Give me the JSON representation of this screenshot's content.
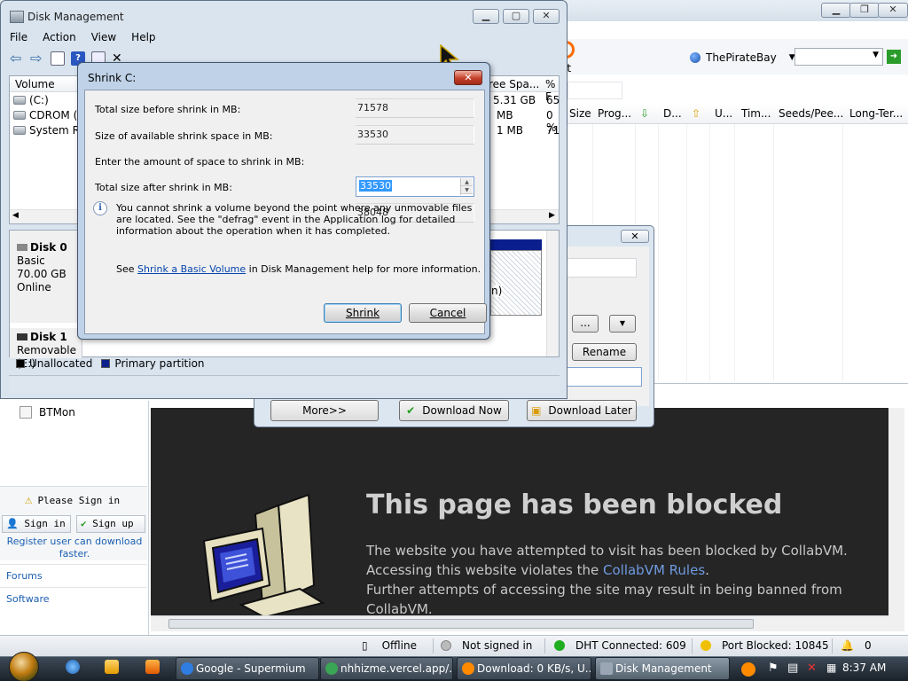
{
  "browser": {
    "search_engine": "ThePirateBay",
    "toolbar_partial_label": "it",
    "columns": [
      "Size",
      "Prog...",
      "D...",
      "U...",
      "Tim...",
      "Seeds/Pee...",
      "Long-Ter..."
    ],
    "left_nav": {
      "btmon": "BTMon",
      "please_sign_in": "Please Sign in",
      "sign_in": "Sign in",
      "sign_up": "Sign up",
      "register": "Register user can download faster.",
      "forums": "Forums",
      "software": "Software"
    },
    "blocked": {
      "title": "This page has been blocked",
      "line1": "The website you have attempted to visit has been blocked by CollabVM.",
      "line2_pre": "Accessing this website violates the ",
      "line2_link": "CollabVM Rules",
      "line2_post": ".",
      "line3": "Further attempts of accessing the site may result in being banned from CollabVM."
    },
    "status": {
      "offline": "Offline",
      "not_signed_in": "Not signed in",
      "dht": "DHT Connected: 609",
      "port": "Port Blocked: 10845",
      "count": "0"
    }
  },
  "download_dialog": {
    "browse": "...",
    "rename": "Rename",
    "more": "More>>",
    "download_now": "Download Now",
    "download_later": "Download Later"
  },
  "disk_management": {
    "title": "Disk Management",
    "menu": [
      "File",
      "Action",
      "View",
      "Help"
    ],
    "columns": {
      "volume": "Volume",
      "free": "ree Spa...",
      "pct": "% F"
    },
    "volumes": [
      {
        "name": "(C:)",
        "free": "5.31 GB",
        "pct": "65"
      },
      {
        "name": "CDROM (D",
        "free": "MB",
        "pct": "0 %"
      },
      {
        "name": "System Res",
        "free": "1 MB",
        "pct": "71"
      }
    ],
    "disk0": {
      "name": "Disk 0",
      "type": "Basic",
      "size": "70.00 GB",
      "status": "Online",
      "part_partial": "n)"
    },
    "disk1": {
      "name": "Disk 1",
      "type": "Removable (E:)"
    },
    "legend": {
      "unallocated": "Unallocated",
      "primary": "Primary partition"
    }
  },
  "shrink_dialog": {
    "title": "Shrink C:",
    "total_before_label": "Total size before shrink in MB:",
    "total_before_value": "71578",
    "available_label": "Size of available shrink space in MB:",
    "available_value": "33530",
    "enter_label": "Enter the amount of space to shrink in MB:",
    "enter_value": "33530",
    "after_label": "Total size after shrink in MB:",
    "after_value": "38048",
    "info": "You cannot shrink a volume beyond the point where any unmovable files are located. See the \"defrag\" event in the Application log for detailed information about the operation when it has completed.",
    "see_pre": "See ",
    "see_link": "Shrink a Basic Volume",
    "see_post": " in Disk Management help for more information.",
    "shrink_button": "Shrink",
    "cancel_button": "Cancel"
  },
  "taskbar": {
    "tasks": [
      "Google - Supermium",
      "nhhizme.vercel.app/...",
      "Download: 0 KB/s, U...",
      "Disk Management"
    ],
    "clock": "8:37 AM"
  }
}
